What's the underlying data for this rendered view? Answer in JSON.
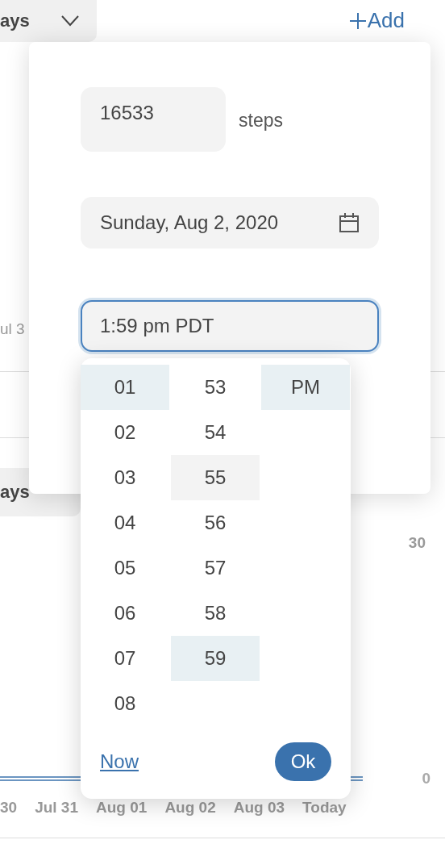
{
  "range_selects": [
    {
      "label": "ays",
      "chevron": true
    },
    {
      "label": "ays",
      "chevron": false
    }
  ],
  "add_button": {
    "label": "Add"
  },
  "upper_chart": {
    "x_label": "ul 3"
  },
  "chart": {
    "y_labels": [
      "30",
      "0"
    ],
    "x_labels": [
      "30",
      "Jul 31",
      "Aug 01",
      "Aug 02",
      "Aug 03",
      "Today"
    ]
  },
  "dialog": {
    "steps": {
      "value": "16533",
      "unit": "steps"
    },
    "date": {
      "value": "Sunday, Aug 2, 2020"
    },
    "time": {
      "value": "1:59 pm PDT",
      "focused": true
    }
  },
  "time_picker": {
    "hours": [
      {
        "label": "01",
        "selected": true,
        "hovered": false
      },
      {
        "label": "02",
        "selected": false,
        "hovered": false
      },
      {
        "label": "03",
        "selected": false,
        "hovered": false
      },
      {
        "label": "04",
        "selected": false,
        "hovered": false
      },
      {
        "label": "05",
        "selected": false,
        "hovered": false
      },
      {
        "label": "06",
        "selected": false,
        "hovered": false
      },
      {
        "label": "07",
        "selected": false,
        "hovered": false
      },
      {
        "label": "08",
        "selected": false,
        "hovered": false
      }
    ],
    "minutes": [
      {
        "label": "53",
        "selected": false,
        "hovered": false
      },
      {
        "label": "54",
        "selected": false,
        "hovered": false
      },
      {
        "label": "55",
        "selected": false,
        "hovered": true
      },
      {
        "label": "56",
        "selected": false,
        "hovered": false
      },
      {
        "label": "57",
        "selected": false,
        "hovered": false
      },
      {
        "label": "58",
        "selected": false,
        "hovered": false
      },
      {
        "label": "59",
        "selected": true,
        "hovered": false
      }
    ],
    "periods": [
      {
        "label": "PM",
        "selected": true,
        "hovered": false
      }
    ],
    "now_link": "Now",
    "ok_button": "Ok"
  }
}
